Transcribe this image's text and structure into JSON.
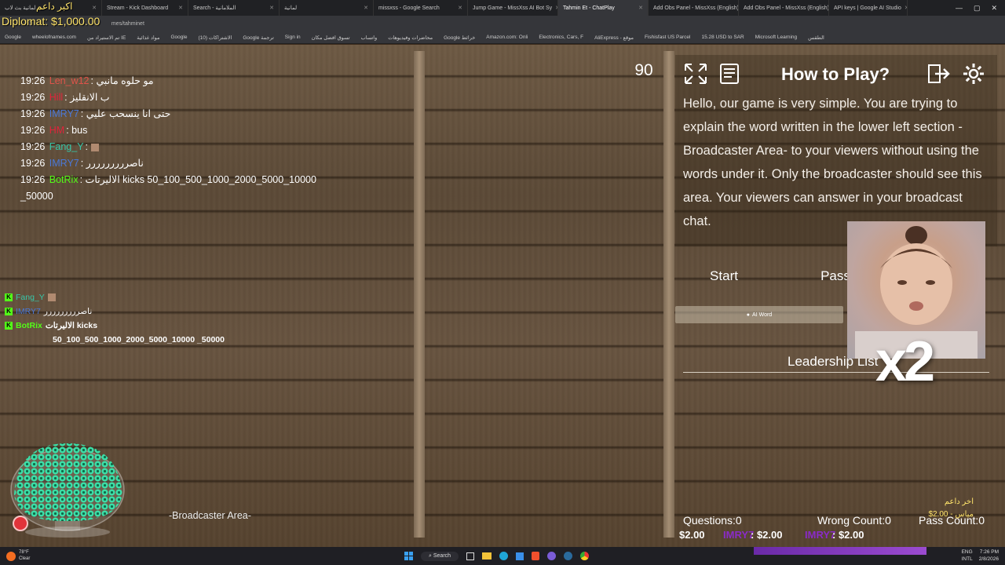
{
  "overlay": {
    "diplomat": "Diplomat: $1,000.00",
    "donor_title": "اكبر داعم"
  },
  "browser": {
    "tabs": [
      {
        "label": "لمانية بث لاب"
      },
      {
        "label": "Stream - Kick Dashboard"
      },
      {
        "label": "Search - الملامانية"
      },
      {
        "label": "لمانية"
      },
      {
        "label": "missxss - Google Search"
      },
      {
        "label": "Jump Game - MissXss AI Bot Sy"
      },
      {
        "label": "Tahmin Et - ChatPlay"
      },
      {
        "label": "Add Obs Panel - MissXss (English)"
      },
      {
        "label": "Add Obs Panel - MissXss (English)"
      },
      {
        "label": "API keys | Google AI Studio"
      }
    ],
    "address": "mes/tahminet",
    "bookmarks": [
      "Google",
      "wheelofnames.com",
      "تم الاستيراد من IE",
      "مواد غذائية",
      "Google",
      "(10) الاشتراكات",
      "Google ترجمة",
      "Sign in",
      "تسوق افضل مكان",
      "واتساب",
      "محاضرات وفيديوهات",
      "Google خرائط",
      "Amazon.com: Onli",
      "Electronics, Cars, F",
      "AliExpress - موقع",
      "Fishisfast US Parcel",
      "15.28 USD to SAR",
      "Microsoft Learning",
      "الطقس"
    ]
  },
  "chat": {
    "messages": [
      {
        "time": "19:26",
        "user": "Len_w12",
        "color": "#e0534a",
        "text": "مو حلوه مانبي"
      },
      {
        "time": "19:26",
        "user": "Hill",
        "color": "#e0233a",
        "text": "ب الانقليز"
      },
      {
        "time": "19:26",
        "user": "IMRY7",
        "color": "#4a78d8",
        "text": "حتى انا ينسحب عليي"
      },
      {
        "time": "19:26",
        "user": "HM",
        "color": "#e0233a",
        "text": "bus"
      },
      {
        "time": "19:26",
        "user": "Fang_Y",
        "color": "#37c6a8",
        "text": ""
      },
      {
        "time": "19:26",
        "user": "IMRY7",
        "color": "#4a78d8",
        "text": "ناصررررررررر"
      },
      {
        "time": "19:26",
        "user": "BotRix",
        "color": "#53fc18",
        "text": "الاليرتات kicks 50_100_500_1000_2000_5000_10000"
      },
      {
        "time": "",
        "user": "",
        "color": "#fff",
        "text": "_50000"
      }
    ],
    "kick_overlay": [
      {
        "user": "Fang_Y",
        "color": "#37c6a8",
        "text": ""
      },
      {
        "user": "IMRY7",
        "color": "#4a78d8",
        "text": "ناصررررررررر"
      },
      {
        "user": "BotRix",
        "color": "#53fc18",
        "text": "الاليرتات kicks"
      },
      {
        "user": "",
        "color": "#fff",
        "text": "50_100_500_1000_2000_5000_10000 _50000"
      }
    ]
  },
  "game": {
    "counter": "90",
    "howto_title": "How to Play?",
    "howto_text": "Hello, our game is very simple. You are trying to explain the word written in the lower left section -Broadcaster Area- to your viewers without using the words under it. Only the broadcaster should see this area. Your viewers can answer in your broadcast chat.",
    "start_label": "Start",
    "pass_label": "Pass",
    "aiword_label": "AI Word",
    "leadership_title": "Leadership List",
    "broadcaster_area": "-Broadcaster Area-",
    "questions": "Questions:0",
    "wrong_count": "Wrong Count:0",
    "pass_count": "Pass Count:0",
    "money_1": "$2.00",
    "money_2_user": "IMRY7",
    "money_2": ": $2.00",
    "money_3_user": "IMRY7",
    "money_3": ": $2.00",
    "last_donor_title": "اخر داعم",
    "last_donor_value": "$2.00 - مياس",
    "multiplier": "x2"
  },
  "taskbar": {
    "weather_temp": "78°F",
    "weather_desc": "Clear",
    "search": "Search",
    "lang": "ENG",
    "lang2": "INTL",
    "time": "7:26 PM",
    "date": "2/8/2026"
  }
}
